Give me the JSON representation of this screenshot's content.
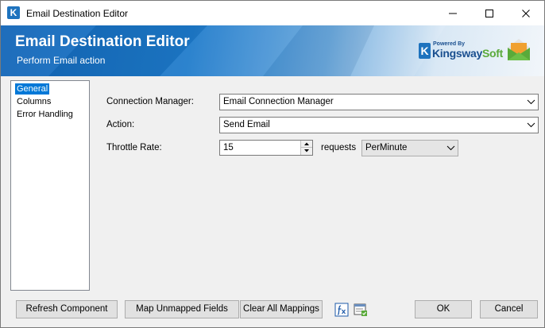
{
  "window": {
    "title": "Email Destination Editor",
    "app_icon": "K"
  },
  "banner": {
    "title": "Email Destination Editor",
    "subtitle": "Perform Email action",
    "brand_powered": "Powered By",
    "brand_name_main": "Kingsway",
    "brand_name_accent": "Soft",
    "brand_k": "K"
  },
  "nav": {
    "items": [
      {
        "label": "General",
        "selected": true
      },
      {
        "label": "Columns",
        "selected": false
      },
      {
        "label": "Error Handling",
        "selected": false
      }
    ]
  },
  "form": {
    "connection_manager": {
      "label": "Connection Manager:",
      "value": "Email Connection Manager"
    },
    "action": {
      "label": "Action:",
      "value": "Send Email"
    },
    "throttle_rate": {
      "label": "Throttle Rate:",
      "value": "15",
      "unit_label": "requests",
      "period": "PerMinute"
    }
  },
  "buttons": {
    "refresh": "Refresh Component",
    "map_unmapped": "Map Unmapped Fields",
    "clear_mappings": "Clear All Mappings",
    "ok": "OK",
    "cancel": "Cancel"
  },
  "icons": {
    "expression": "fx-icon",
    "variables": "variables-icon"
  },
  "colors": {
    "accent": "#0078d7",
    "brand_blue": "#1e73be",
    "brand_green": "#5aaa3a"
  }
}
